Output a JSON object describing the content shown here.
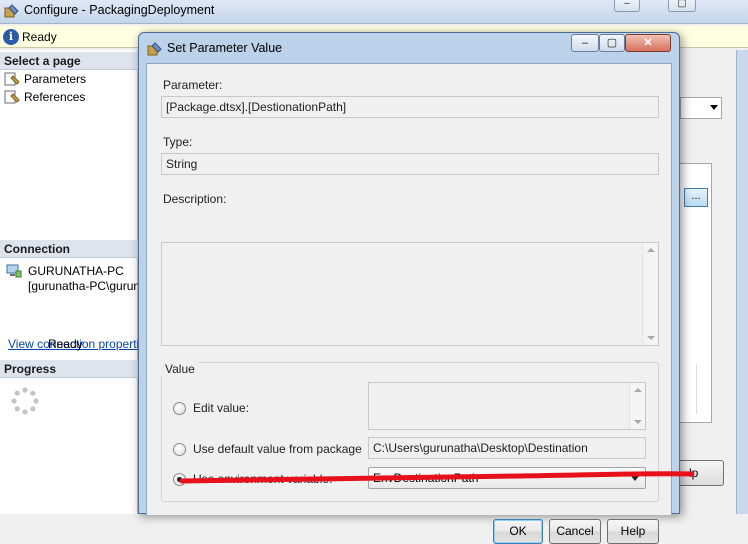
{
  "background_window": {
    "title": "Configure - PackagingDeployment",
    "status": "Ready",
    "select_page_heading": "Select a page",
    "pages": [
      "Parameters",
      "References"
    ],
    "connection_heading": "Connection",
    "connection_server": "GURUNATHA-PC",
    "connection_user": "[gurunatha-PC\\gurunatha]",
    "connection_link": "View connection properties",
    "progress_heading": "Progress",
    "progress_status": "Ready",
    "ellipsis_button": "...",
    "help_button_partial": "lp"
  },
  "dialog": {
    "title": "Set Parameter Value",
    "parameter_label": "Parameter:",
    "parameter_value": "[Package.dtsx].[DestionationPath]",
    "type_label": "Type:",
    "type_value": "String",
    "description_label": "Description:",
    "description_value": "",
    "value_group_title": "Value",
    "edit_value_label": "Edit value:",
    "default_value_label": "Use default value from package",
    "default_value": "C:\\Users\\gurunatha\\Desktop\\Destination",
    "env_var_label": "Use environment variable:",
    "env_var_selected": "EnvDestinationPath",
    "ok_label": "OK",
    "cancel_label": "Cancel",
    "help_label": "Help"
  },
  "colors": {
    "annotation_red": "#e8101a",
    "dialog_frame": "#bcd1ea",
    "link": "#0645ad"
  }
}
